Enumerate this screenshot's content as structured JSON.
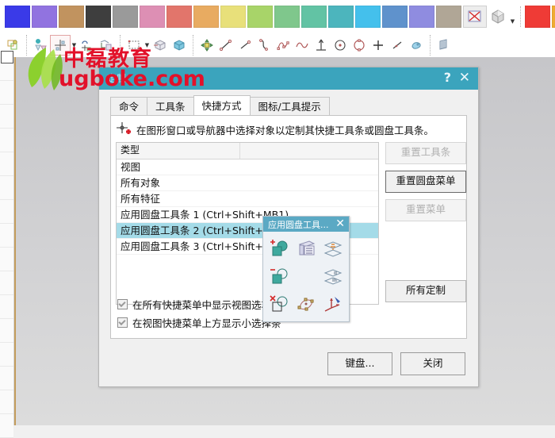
{
  "toolbars": {
    "color_toolbar": {
      "name": "color-palette-toolbar",
      "swatches": [
        {
          "name": "swatch-blue",
          "color": "#3a3ae8"
        },
        {
          "name": "swatch-purple",
          "color": "#9173e0"
        },
        {
          "name": "swatch-tan",
          "color": "#c1935f"
        },
        {
          "name": "swatch-dark-gray",
          "color": "#3e3e3e"
        },
        {
          "name": "swatch-gray",
          "color": "#9a9a9a"
        },
        {
          "name": "swatch-pink",
          "color": "#dd8fb4"
        },
        {
          "name": "swatch-salmon",
          "color": "#e2756b"
        },
        {
          "name": "swatch-orange",
          "color": "#e8ab61"
        },
        {
          "name": "swatch-yellow",
          "color": "#e8e07a"
        },
        {
          "name": "swatch-light-green",
          "color": "#a8d469"
        },
        {
          "name": "swatch-green",
          "color": "#7fc78c"
        },
        {
          "name": "swatch-teal-green",
          "color": "#62c3a4"
        },
        {
          "name": "swatch-teal",
          "color": "#4cb5bd"
        },
        {
          "name": "swatch-cyan",
          "color": "#44c0ec"
        },
        {
          "name": "swatch-steel-blue",
          "color": "#5f92cc"
        },
        {
          "name": "swatch-violet",
          "color": "#8f8ce0"
        },
        {
          "name": "swatch-warm-gray",
          "color": "#b0a696"
        }
      ],
      "extra_swatches": [
        {
          "name": "swatch-red",
          "color": "#ef3b36"
        },
        {
          "name": "swatch-amber",
          "color": "#efac32"
        },
        {
          "name": "swatch-bright-yellow",
          "color": "#efe93c"
        }
      ],
      "buttons": [
        {
          "name": "no-color-button",
          "icon": "no-color-icon"
        },
        {
          "name": "shaded-cube-button",
          "icon": "cube-icon"
        },
        {
          "name": "color-overflow-arrow",
          "icon": "chevron-down-icon"
        }
      ]
    },
    "curve_toolbar": {
      "name": "curve-toolbar",
      "groups": [
        {
          "name": "datum-csys-button",
          "icon": "datum-csys-icon"
        },
        {
          "name": "datum-plane-button",
          "icon": "datum-plane-icon"
        },
        {
          "name": "datum-point-button",
          "icon": "datum-point-icon"
        },
        {
          "name": "datum-dropdown-arrow",
          "icon": "chevron-down-icon"
        },
        {
          "name": "sketch-curve-button",
          "icon": "sketch-curve-icon"
        },
        {
          "name": "sketch-section-button",
          "icon": "sketch-section-icon"
        },
        {
          "name": "rectangle-select-button",
          "icon": "rectangle-icon"
        },
        {
          "name": "rectangle-dropdown-arrow",
          "icon": "chevron-down-icon"
        },
        {
          "name": "extrude-button",
          "icon": "extrude-icon"
        },
        {
          "name": "revolve-button",
          "icon": "revolve-icon"
        },
        {
          "name": "move-object-button",
          "icon": "move-object-icon"
        },
        {
          "name": "line-button",
          "icon": "line-icon"
        },
        {
          "name": "line2-button",
          "icon": "line-icon"
        },
        {
          "name": "arc-button",
          "icon": "arc-icon"
        },
        {
          "name": "studio-spline-button",
          "icon": "spline-icon"
        },
        {
          "name": "helix-button",
          "icon": "wave-icon"
        },
        {
          "name": "normal-line-button",
          "icon": "perpendicular-icon"
        },
        {
          "name": "circle-center-button",
          "icon": "circle-center-icon"
        },
        {
          "name": "circle-button",
          "icon": "circle-icon"
        },
        {
          "name": "point-button",
          "icon": "plus-icon"
        },
        {
          "name": "line-dash-button",
          "icon": "line-dash-icon"
        },
        {
          "name": "fill-region-button",
          "icon": "fill-region-icon"
        },
        {
          "name": "pattern-button",
          "icon": "pattern-icon"
        }
      ]
    }
  },
  "watermark": {
    "chinese": "中磊教育",
    "url": "ugboke.com",
    "color": "#e2112a",
    "leaf_icon": "leaf-logo-icon"
  },
  "dialog": {
    "title": "定制",
    "titlebar_color": "#3ba4bd",
    "help_glyph": "?",
    "close_glyph": "✕",
    "tabs": [
      {
        "label": "命令",
        "active": false
      },
      {
        "label": "工具条",
        "active": false
      },
      {
        "label": "快捷方式",
        "active": true
      },
      {
        "label": "图标/工具提示",
        "active": false
      }
    ],
    "hint": "在图形窗口或导航器中选择对象以定制其快捷工具条或圆盘工具条。",
    "hint_icon": "point-crosshair-icon",
    "list": {
      "columns": [
        "类型",
        ""
      ],
      "rows": [
        {
          "text": "视图",
          "selected": false
        },
        {
          "text": "所有对象",
          "selected": false
        },
        {
          "text": "所有特征",
          "selected": false
        },
        {
          "text": "应用圆盘工具条 1 (Ctrl+Shift+MB1)",
          "selected": false
        },
        {
          "text": "应用圆盘工具条 2 (Ctrl+Shift+MB2)",
          "selected": true
        },
        {
          "text": "应用圆盘工具条 3 (Ctrl+Shift+MB3)",
          "selected": false
        }
      ]
    },
    "side_buttons": [
      {
        "label": "重置工具条",
        "name": "reset-toolbar-button",
        "disabled": true
      },
      {
        "label": "重置圆盘菜单",
        "name": "reset-dial-menu-button",
        "disabled": false
      },
      {
        "label": "重置菜单",
        "name": "reset-menu-button",
        "disabled": true
      }
    ],
    "all_custom_button": {
      "label": "所有定制",
      "name": "all-customizations-button"
    },
    "checkboxes": [
      {
        "label": "在所有快捷菜单中显示视图选项",
        "checked": true,
        "name": "show-view-options-checkbox"
      },
      {
        "label": "在视图快捷菜单上方显示小选择条",
        "checked": true,
        "name": "show-mini-select-bar-checkbox"
      }
    ],
    "footer_buttons": [
      {
        "label": "键盘...",
        "name": "keyboard-button"
      },
      {
        "label": "关闭",
        "name": "close-button"
      }
    ]
  },
  "popup": {
    "title": "应用圆盘工具...",
    "titlebar_color": "#5ba9c4",
    "close_glyph": "✕",
    "items": [
      {
        "name": "create-point-icon",
        "present": true
      },
      {
        "name": "layer-settings-icon",
        "present": true
      },
      {
        "name": "show-hide-objects-icon",
        "present": true
      },
      {
        "name": "subtract-region-icon",
        "present": true
      },
      {
        "name": "empty-slot",
        "present": false
      },
      {
        "name": "move-to-layer-icon",
        "present": true
      },
      {
        "name": "delete-region-icon",
        "present": true
      },
      {
        "name": "edit-object-display-icon",
        "present": true
      },
      {
        "name": "wcs-orient-icon",
        "present": true
      }
    ]
  }
}
